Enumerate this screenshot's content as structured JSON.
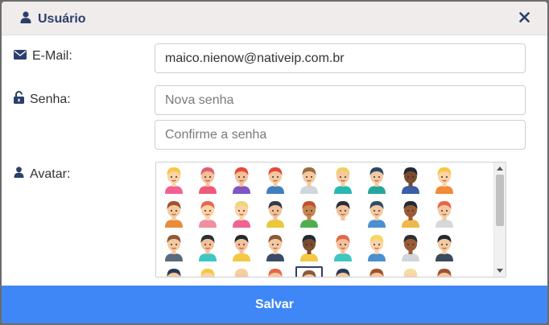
{
  "header": {
    "title": "Usuário",
    "close_icon": "close-icon"
  },
  "form": {
    "email_label": "E-Mail:",
    "email_value": "maico.nienow@nativeip.com.br",
    "password_label": "Senha:",
    "password_placeholder": "Nova senha",
    "confirm_placeholder": "Confirme a senha",
    "avatar_label": "Avatar:"
  },
  "avatars": [
    {
      "hair": "#f5c842",
      "skin": "#fcd2a7",
      "shirt": "#f06292"
    },
    {
      "hair": "#e06070",
      "skin": "#f3c09a",
      "shirt": "#ef5a7a"
    },
    {
      "hair": "#e64a3c",
      "skin": "#f3c09a",
      "shirt": "#7e57c2"
    },
    {
      "hair": "#e64a3c",
      "skin": "#f5c9a0",
      "shirt": "#3f7fbf"
    },
    {
      "hair": "#9a6b45",
      "skin": "#f5c9a0",
      "shirt": "#d0d6dc"
    },
    {
      "hair": "#f2cf63",
      "skin": "#f5c9a0",
      "shirt": "#27b8b0"
    },
    {
      "hair": "#2b4a6b",
      "skin": "#f5c9a0",
      "shirt": "#26a69a"
    },
    {
      "hair": "#1f2a36",
      "skin": "#7a4b2e",
      "shirt": "#3a5ea8"
    },
    {
      "hair": "#f5c842",
      "skin": "#fcd2a7",
      "shirt": "#f28a3a"
    },
    {
      "hair": "#a0522d",
      "skin": "#f5c9a0",
      "shirt": "#e98d3a"
    },
    {
      "hair": "#e8654a",
      "skin": "#fcd2a7",
      "shirt": "#ef8fa0"
    },
    {
      "hair": "#f2d57a",
      "skin": "#fcd2a7",
      "shirt": "#f06292"
    },
    {
      "hair": "#333b4a",
      "skin": "#f3c09a",
      "shirt": "#e8c93a"
    },
    {
      "hair": "#c05030",
      "skin": "#c68650",
      "shirt": "#4caf50"
    },
    {
      "hair": "#2b2f3a",
      "skin": "#f3c09a",
      "shirt": "#ffffff"
    },
    {
      "hair": "#2f4b68",
      "skin": "#f5c9a0",
      "shirt": "#4a8fd0"
    },
    {
      "hair": "#1f2a36",
      "skin": "#9a5c36",
      "shirt": "#f0b84a"
    },
    {
      "hair": "#e8654a",
      "skin": "#f5c9a0",
      "shirt": "#d8d8d8"
    },
    {
      "hair": "#8a5a3a",
      "skin": "#f5c9a0",
      "shirt": "#5a6a7a"
    },
    {
      "hair": "#2b2f3a",
      "skin": "#f3c09a",
      "shirt": "#3ec6c2"
    },
    {
      "hair": "#1f2a36",
      "skin": "#f3c09a",
      "shirt": "#f5c842"
    },
    {
      "hair": "#8a5a3a",
      "skin": "#f5c9a0",
      "shirt": "#3a4a6a"
    },
    {
      "hair": "#1f2a36",
      "skin": "#7a4b2e",
      "shirt": "#f5c842"
    },
    {
      "hair": "#e8654a",
      "skin": "#f3c09a",
      "shirt": "#3ec6c2"
    },
    {
      "hair": "#f5d95a",
      "skin": "#fcd2a7",
      "shirt": "#4a8fd0"
    },
    {
      "hair": "#2b2f3a",
      "skin": "#9a5c36",
      "shirt": "#d0d6dc"
    },
    {
      "hair": "#1f2a36",
      "skin": "#f5c9a0",
      "shirt": "#3a4a5a"
    },
    {
      "hair": "#2b3a5a",
      "skin": "#f5c9a0",
      "shirt": "#f5c842"
    },
    {
      "hair": "#f5c842",
      "skin": "#fcd2a7",
      "shirt": "#ffffff"
    },
    {
      "hair": "#f5d0a0",
      "skin": "#f5c9a0",
      "shirt": "#ffffff"
    },
    {
      "hair": "#e8654a",
      "skin": "#f5c9a0",
      "shirt": "#ffffff"
    },
    {
      "hair": "#8a5a3a",
      "skin": "#f5c9a0",
      "shirt": "#ffffff"
    },
    {
      "hair": "#2b3a5a",
      "skin": "#f5c9a0",
      "shirt": "#ffffff"
    },
    {
      "hair": "#a0522d",
      "skin": "#f5c9a0",
      "shirt": "#ffffff"
    },
    {
      "hair": "#f2e0a0",
      "skin": "#fcd2a7",
      "shirt": "#ffffff"
    },
    {
      "hair": "#a0522d",
      "skin": "#f5c9a0",
      "shirt": "#ffffff"
    }
  ],
  "selected_avatar_index": 31,
  "footer": {
    "save_label": "Salvar"
  },
  "colors": {
    "accent": "#3f86f7",
    "title": "#2c3e6b"
  }
}
